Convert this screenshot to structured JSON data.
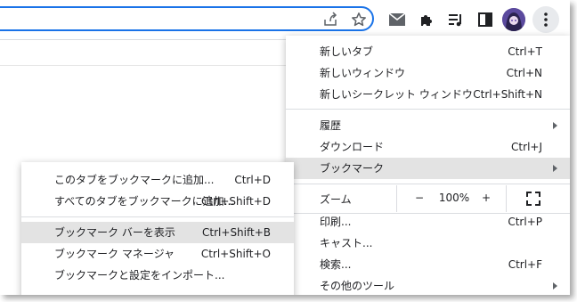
{
  "main_menu": {
    "items": [
      {
        "label": "新しいタブ",
        "shortcut": "Ctrl+T"
      },
      {
        "label": "新しいウィンドウ",
        "shortcut": "Ctrl+N"
      },
      {
        "label": "新しいシークレット ウィンドウ",
        "shortcut": "Ctrl+Shift+N"
      },
      {
        "label": "履歴",
        "shortcut": ""
      },
      {
        "label": "ダウンロード",
        "shortcut": "Ctrl+J"
      },
      {
        "label": "ブックマーク",
        "shortcut": ""
      },
      {
        "label": "印刷...",
        "shortcut": "Ctrl+P"
      },
      {
        "label": "キャスト...",
        "shortcut": ""
      },
      {
        "label": "検索...",
        "shortcut": "Ctrl+F"
      },
      {
        "label": "その他のツール",
        "shortcut": ""
      }
    ],
    "zoom": {
      "label": "ズーム",
      "minus": "−",
      "value": "100%",
      "plus": "+"
    }
  },
  "bookmark_submenu": {
    "items": [
      {
        "label": "このタブをブックマークに追加...",
        "shortcut": "Ctrl+D"
      },
      {
        "label": "すべてのタブをブックマークに追加...",
        "shortcut": "Ctrl+Shift+D"
      },
      {
        "label": "ブックマーク バーを表示",
        "shortcut": "Ctrl+Shift+B"
      },
      {
        "label": "ブックマーク マネージャ",
        "shortcut": "Ctrl+Shift+O"
      },
      {
        "label": "ブックマークと設定をインポート...",
        "shortcut": ""
      }
    ]
  },
  "colors": {
    "accent": "#1a73e8",
    "highlight": "#e3e3e3"
  },
  "icons": [
    "share-icon",
    "star-icon",
    "mail-icon",
    "extensions-icon",
    "reading-list-icon",
    "side-panel-icon",
    "avatar",
    "kebab-menu-icon",
    "fullscreen-icon"
  ]
}
